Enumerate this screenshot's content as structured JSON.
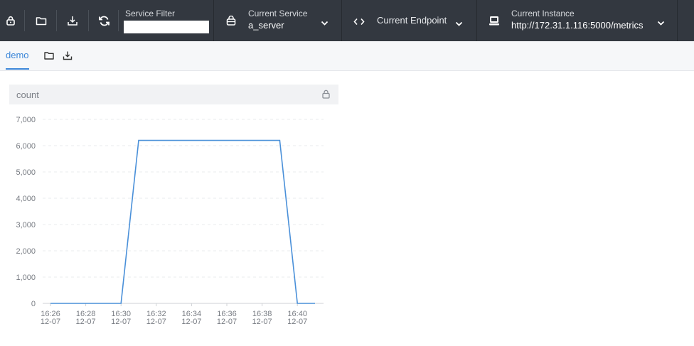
{
  "toolbar": {
    "service_filter": {
      "label": "Service Filter",
      "value": ""
    },
    "current_service": {
      "label": "Current Service",
      "value": "a_server"
    },
    "current_endpoint": {
      "label": "Current Endpoint"
    },
    "current_instance": {
      "label": "Current Instance",
      "value": "http://172.31.1.116:5000/metrics"
    }
  },
  "tabs": [
    {
      "label": "demo",
      "active": true
    }
  ],
  "panel": {
    "title": "count"
  },
  "colors": {
    "accent": "#3d87d9",
    "topbar": "#333840",
    "line": "#4a90d9"
  },
  "chart_data": {
    "type": "line",
    "y_ticks": [
      "0",
      "1,000",
      "2,000",
      "3,000",
      "4,000",
      "5,000",
      "6,000",
      "7,000"
    ],
    "ylim": [
      0,
      7000
    ],
    "x_ticks": [
      {
        "time": "16:26",
        "date": "12-07"
      },
      {
        "time": "16:28",
        "date": "12-07"
      },
      {
        "time": "16:30",
        "date": "12-07"
      },
      {
        "time": "16:32",
        "date": "12-07"
      },
      {
        "time": "16:34",
        "date": "12-07"
      },
      {
        "time": "16:36",
        "date": "12-07"
      },
      {
        "time": "16:38",
        "date": "12-07"
      },
      {
        "time": "16:40",
        "date": "12-07"
      }
    ],
    "series": [
      {
        "points": [
          {
            "t": "16:26",
            "v": 0
          },
          {
            "t": "16:30",
            "v": 0
          },
          {
            "t": "16:31",
            "v": 6200
          },
          {
            "t": "16:39",
            "v": 6200
          },
          {
            "t": "16:40",
            "v": 0
          },
          {
            "t": "16:41",
            "v": 0
          }
        ]
      }
    ],
    "grid": true
  }
}
